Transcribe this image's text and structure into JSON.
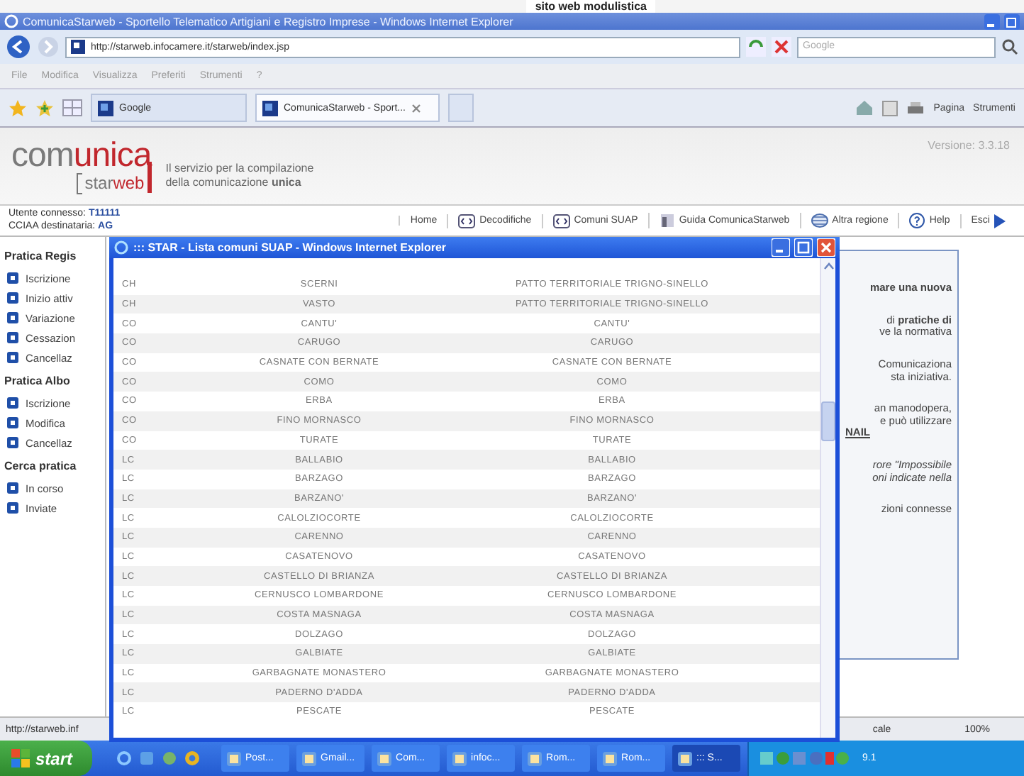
{
  "background_window": {
    "text": "sito web modulistica"
  },
  "window": {
    "title": "ComunicaStarweb - Sportello Telematico Artigiani e Registro Imprese - Windows Internet Explorer"
  },
  "address_bar": {
    "url": "http://starweb.infocamere.it/starweb/index.jsp",
    "search_placeholder": "Google"
  },
  "menu": [
    "File",
    "Modifica",
    "Visualizza",
    "Preferiti",
    "Strumenti",
    "?"
  ],
  "tabs": [
    {
      "label": "Google",
      "selected": false
    },
    {
      "label": "ComunicaStarweb - Sport...",
      "selected": true
    }
  ],
  "command_bar": [
    "Pagina",
    "Strumenti"
  ],
  "header": {
    "logo_a": "com",
    "logo_b": "unica",
    "logo_c": "star",
    "logo_d": "web",
    "tagline": [
      "Il servizio per la compilazione",
      "della comunicazione **unica**"
    ],
    "version": "Versione: 3.3.18"
  },
  "user": {
    "label_1": "Utente connesso:",
    "value_1": "T11111",
    "label_2": "CCIAA destinataria:",
    "value_2": "AG"
  },
  "nav": [
    {
      "label": "Home",
      "kind": "plain"
    },
    {
      "label": "Decodifiche",
      "kind": "code"
    },
    {
      "label": "Comuni SUAP",
      "kind": "code"
    },
    {
      "label": "Guida ComunicaStarweb",
      "kind": "guide"
    },
    {
      "label": "Altra regione",
      "kind": "region"
    },
    {
      "label": "Help",
      "kind": "help"
    },
    {
      "label": "Esci",
      "kind": "exit"
    }
  ],
  "sidebar": [
    {
      "title": "Pratica Regis",
      "items": [
        "Iscrizione",
        "Inizio attiv",
        "Variazione",
        "Cessazion",
        "Cancellaz"
      ]
    },
    {
      "title": "Pratica Albo",
      "items": [
        "Iscrizione",
        "Modifica",
        "Cancellaz"
      ]
    },
    {
      "title": "Cerca pratica",
      "items": [
        "In corso",
        "Inviate"
      ]
    }
  ],
  "info_panel": [
    {
      "kind": "heading",
      "lines": [
        "mare una nuova"
      ]
    },
    {
      "kind": "text",
      "lines": [
        "di **pratiche di**",
        "ve la normativa"
      ]
    },
    {
      "kind": "text",
      "lines": [
        "Comunicaziona",
        "sta iniziativa."
      ]
    },
    {
      "kind": "text",
      "lines": [
        "an manodopera,",
        "e può utilizzare"
      ],
      "link": "NAIL"
    },
    {
      "kind": "quote",
      "lines": [
        "rore \"Impossibile",
        "oni indicate nella"
      ]
    },
    {
      "kind": "text",
      "lines": [
        "zioni connesse"
      ]
    }
  ],
  "status_bar": {
    "url": "http://starweb.inf",
    "zone": "cale",
    "zoom": "100%"
  },
  "popup": {
    "title": "::: STAR - Lista comuni SUAP - Windows Internet Explorer",
    "rows": [
      [
        "CH",
        "SCERNI",
        "PATTO TERRITORIALE TRIGNO-SINELLO"
      ],
      [
        "CH",
        "VASTO",
        "PATTO TERRITORIALE TRIGNO-SINELLO"
      ],
      [
        "CO",
        "CANTU'",
        "CANTU'"
      ],
      [
        "CO",
        "CARUGO",
        "CARUGO"
      ],
      [
        "CO",
        "CASNATE CON BERNATE",
        "CASNATE CON BERNATE"
      ],
      [
        "CO",
        "COMO",
        "COMO"
      ],
      [
        "CO",
        "ERBA",
        "ERBA"
      ],
      [
        "CO",
        "FINO MORNASCO",
        "FINO MORNASCO"
      ],
      [
        "CO",
        "TURATE",
        "TURATE"
      ],
      [
        "LC",
        "BALLABIO",
        "BALLABIO"
      ],
      [
        "LC",
        "BARZAGO",
        "BARZAGO"
      ],
      [
        "LC",
        "BARZANO'",
        "BARZANO'"
      ],
      [
        "LC",
        "CALOLZIOCORTE",
        "CALOLZIOCORTE"
      ],
      [
        "LC",
        "CARENNO",
        "CARENNO"
      ],
      [
        "LC",
        "CASATENOVO",
        "CASATENOVO"
      ],
      [
        "LC",
        "CASTELLO DI BRIANZA",
        "CASTELLO DI BRIANZA"
      ],
      [
        "LC",
        "CERNUSCO LOMBARDONE",
        "CERNUSCO LOMBARDONE"
      ],
      [
        "LC",
        "COSTA MASNAGA",
        "COSTA MASNAGA"
      ],
      [
        "LC",
        "DOLZAGO",
        "DOLZAGO"
      ],
      [
        "LC",
        "GALBIATE",
        "GALBIATE"
      ],
      [
        "LC",
        "GARBAGNATE MONASTERO",
        "GARBAGNATE MONASTERO"
      ],
      [
        "LC",
        "PADERNO D'ADDA",
        "PADERNO D'ADDA"
      ],
      [
        "LC",
        "PESCATE",
        "PESCATE"
      ]
    ]
  },
  "taskbar": {
    "start": "start",
    "buttons": [
      {
        "label": "Post...",
        "selected": false
      },
      {
        "label": "Gmail...",
        "selected": false
      },
      {
        "label": "Com...",
        "selected": false
      },
      {
        "label": "infoc...",
        "selected": false
      },
      {
        "label": "Rom...",
        "selected": false
      },
      {
        "label": "Rom...",
        "selected": false
      },
      {
        "label": "::: S...",
        "selected": true
      }
    ],
    "clock": "9.1"
  }
}
